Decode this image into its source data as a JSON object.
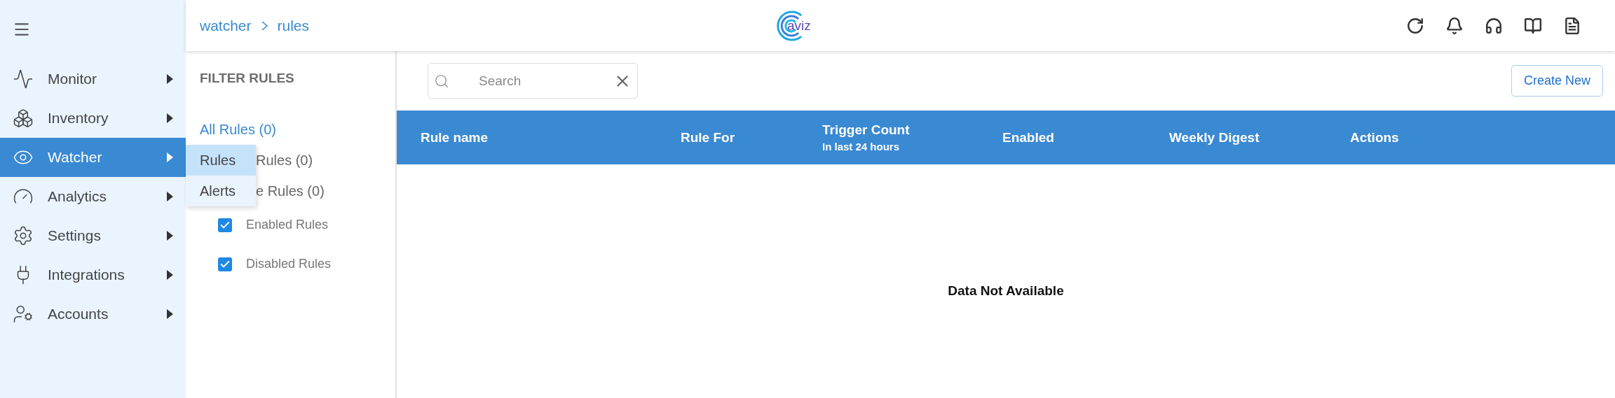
{
  "sidebar": {
    "items": [
      {
        "label": "Monitor",
        "selected": false
      },
      {
        "label": "Inventory",
        "selected": false
      },
      {
        "label": "Watcher",
        "selected": true
      },
      {
        "label": "Analytics",
        "selected": false
      },
      {
        "label": "Settings",
        "selected": false
      },
      {
        "label": "Integrations",
        "selected": false
      },
      {
        "label": "Accounts",
        "selected": false
      }
    ],
    "submenu": [
      {
        "label": "Rules",
        "selected": true
      },
      {
        "label": "Alerts",
        "selected": false
      }
    ]
  },
  "breadcrumb": [
    "watcher",
    "rules"
  ],
  "logo": "aviz",
  "filter": {
    "title": "FILTER RULES",
    "items": [
      {
        "label": "All Rules (0)",
        "selected": true
      },
      {
        "label": "Rules (0)",
        "selected": false
      },
      {
        "label": "e Rules (0)",
        "selected": false
      }
    ],
    "checkboxes": [
      {
        "label": "Enabled Rules",
        "checked": true
      },
      {
        "label": "Disabled Rules",
        "checked": true
      }
    ]
  },
  "search": {
    "placeholder": "Search"
  },
  "create_button": "Create New",
  "table": {
    "columns": [
      {
        "label": "Rule name"
      },
      {
        "label": "Rule For"
      },
      {
        "label": "Trigger Count",
        "sub": "In last 24 hours"
      },
      {
        "label": "Enabled"
      },
      {
        "label": "Weekly Digest"
      },
      {
        "label": "Actions"
      }
    ],
    "empty": "Data Not Available"
  }
}
